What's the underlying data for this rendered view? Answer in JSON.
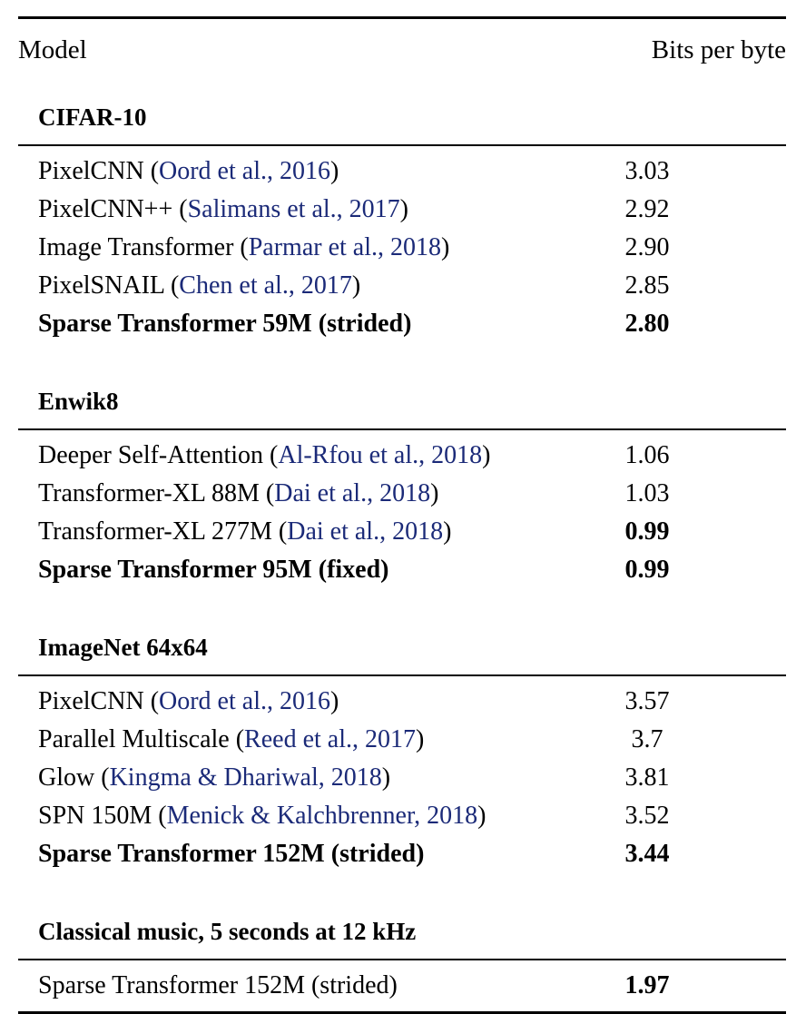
{
  "table": {
    "caption_present": false,
    "columns": [
      {
        "key": "model",
        "label": "Model",
        "align": "left"
      },
      {
        "key": "bits_per_byte",
        "label": "Bits per byte",
        "align": "center"
      }
    ],
    "citation_color": "#1b2a78",
    "text_color": "#000000",
    "rule_color": "#000000",
    "sections": [
      {
        "id": "cifar10",
        "heading": "CIFAR-10",
        "rows": [
          {
            "name_prefix": "PixelCNN ",
            "citation": "Oord et al., 2016",
            "name_bold": false,
            "value": "3.03",
            "value_bold": false
          },
          {
            "name_prefix": "PixelCNN++ ",
            "citation": "Salimans et al., 2017",
            "name_bold": false,
            "value": "2.92",
            "value_bold": false
          },
          {
            "name_prefix": "Image Transformer ",
            "citation": "Parmar et al., 2018",
            "name_bold": false,
            "value": "2.90",
            "value_bold": false
          },
          {
            "name_prefix": "PixelSNAIL ",
            "citation": "Chen et al., 2017",
            "name_bold": false,
            "value": "2.85",
            "value_bold": false
          },
          {
            "name_prefix": "Sparse Transformer 59M (strided)",
            "citation": "",
            "name_bold": true,
            "value": "2.80",
            "value_bold": true
          }
        ]
      },
      {
        "id": "enwik8",
        "heading": "Enwik8",
        "rows": [
          {
            "name_prefix": "Deeper Self-Attention ",
            "citation": "Al-Rfou et al., 2018",
            "name_bold": false,
            "value": "1.06",
            "value_bold": false
          },
          {
            "name_prefix": "Transformer-XL 88M ",
            "citation": "Dai et al., 2018",
            "name_bold": false,
            "value": "1.03",
            "value_bold": false
          },
          {
            "name_prefix": "Transformer-XL 277M ",
            "citation": "Dai et al., 2018",
            "name_bold": false,
            "value": "0.99",
            "value_bold": true
          },
          {
            "name_prefix": "Sparse Transformer 95M (fixed)",
            "citation": "",
            "name_bold": true,
            "value": "0.99",
            "value_bold": true
          }
        ]
      },
      {
        "id": "imagenet64",
        "heading": "ImageNet 64x64",
        "rows": [
          {
            "name_prefix": "PixelCNN ",
            "citation": "Oord et al., 2016",
            "name_bold": false,
            "value": "3.57",
            "value_bold": false
          },
          {
            "name_prefix": "Parallel Multiscale ",
            "citation": "Reed et al., 2017",
            "name_bold": false,
            "value": "3.7",
            "value_bold": false
          },
          {
            "name_prefix": "Glow ",
            "citation": "Kingma & Dhariwal",
            "citation_suffix": ", 2018",
            "citation_suffix_color": "cite",
            "name_bold": false,
            "value": "3.81",
            "value_bold": false
          },
          {
            "name_prefix": "SPN 150M ",
            "citation": "Menick & Kalchbrenner",
            "citation_suffix": ", 2018",
            "citation_suffix_color": "cite",
            "name_bold": false,
            "value": "3.52",
            "value_bold": false
          },
          {
            "name_prefix": "Sparse Transformer 152M (strided)",
            "citation": "",
            "name_bold": true,
            "value": "3.44",
            "value_bold": true
          }
        ]
      },
      {
        "id": "classical-music",
        "heading": "Classical music, 5 seconds at 12 kHz",
        "rows": [
          {
            "name_prefix": "Sparse Transformer 152M (strided)",
            "citation": "",
            "name_bold": false,
            "value": "1.97",
            "value_bold": true
          }
        ]
      }
    ]
  }
}
